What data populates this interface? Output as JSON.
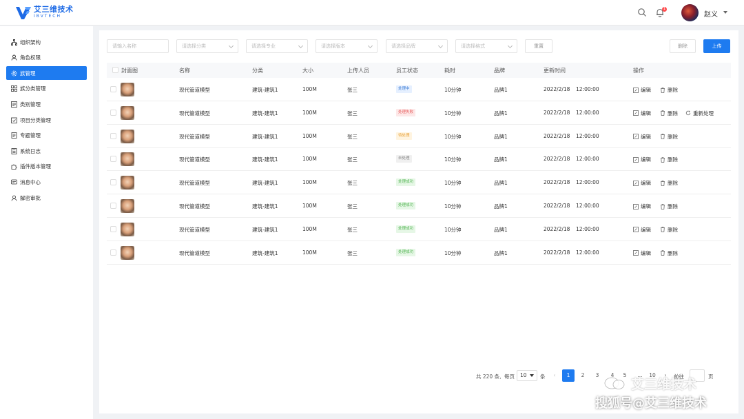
{
  "header": {
    "logo_cn": "艾三维技术",
    "logo_en": "IBVTECH",
    "notification_count": "1",
    "username": "赵义"
  },
  "sidebar": {
    "items": [
      {
        "label": "组织架构",
        "icon": "org-icon"
      },
      {
        "label": "角色权限",
        "icon": "user-icon"
      },
      {
        "label": "族管理",
        "icon": "gear-icon",
        "active": true
      },
      {
        "label": "族分类管理",
        "icon": "grid-icon"
      },
      {
        "label": "类别管理",
        "icon": "list-icon"
      },
      {
        "label": "项目分类管理",
        "icon": "task-icon"
      },
      {
        "label": "专题管理",
        "icon": "doc-icon"
      },
      {
        "label": "系统日志",
        "icon": "log-icon"
      },
      {
        "label": "插件版本管理",
        "icon": "puzzle-icon"
      },
      {
        "label": "消息中心",
        "icon": "message-icon"
      },
      {
        "label": "解密审批",
        "icon": "approve-icon"
      }
    ]
  },
  "filters": {
    "name_placeholder": "请输入名称",
    "category_placeholder": "请选择分类",
    "major_placeholder": "请选择专业",
    "version_placeholder": "请选择版本",
    "brand_placeholder": "请选择品牌",
    "format_placeholder": "请选择格式",
    "reset_label": "重置",
    "delete_label": "删除",
    "upload_label": "上传"
  },
  "table": {
    "headers": [
      "封面图",
      "名称",
      "分类",
      "大小",
      "上传人员",
      "员工状态",
      "耗时",
      "品牌",
      "更新时间",
      "操作"
    ],
    "rows": [
      {
        "name": "现代管道模型",
        "category": "建筑-建筑1",
        "size": "100M",
        "uploader": "张三",
        "status": "处理中",
        "status_type": "processing",
        "duration": "10分钟",
        "brand": "品牌1",
        "date": "2022/2/18",
        "time": "12:00:00",
        "reprocess": false
      },
      {
        "name": "现代管道模型",
        "category": "建筑-建筑1",
        "size": "100M",
        "uploader": "张三",
        "status": "处理失败",
        "status_type": "failed",
        "duration": "10分钟",
        "brand": "品牌1",
        "date": "2022/2/18",
        "time": "12:00:00",
        "reprocess": true
      },
      {
        "name": "现代管道模型",
        "category": "建筑-建筑1",
        "size": "100M",
        "uploader": "张三",
        "status": "待处理",
        "status_type": "pending",
        "duration": "10分钟",
        "brand": "品牌1",
        "date": "2022/2/18",
        "time": "12:00:00",
        "reprocess": false
      },
      {
        "name": "现代管道模型",
        "category": "建筑-建筑1",
        "size": "100M",
        "uploader": "张三",
        "status": "未处理",
        "status_type": "none",
        "duration": "10分钟",
        "brand": "品牌1",
        "date": "2022/2/18",
        "time": "12:00:00",
        "reprocess": false
      },
      {
        "name": "现代管道模型",
        "category": "建筑-建筑1",
        "size": "100M",
        "uploader": "张三",
        "status": "处理成功",
        "status_type": "success",
        "duration": "10分钟",
        "brand": "品牌1",
        "date": "2022/2/18",
        "time": "12:00:00",
        "reprocess": false
      },
      {
        "name": "现代管道模型",
        "category": "建筑-建筑1",
        "size": "100M",
        "uploader": "张三",
        "status": "处理成功",
        "status_type": "success",
        "duration": "10分钟",
        "brand": "品牌1",
        "date": "2022/2/18",
        "time": "12:00:00",
        "reprocess": false
      },
      {
        "name": "现代管道模型",
        "category": "建筑-建筑1",
        "size": "100M",
        "uploader": "张三",
        "status": "处理成功",
        "status_type": "success",
        "duration": "10分钟",
        "brand": "品牌1",
        "date": "2022/2/18",
        "time": "12:00:00",
        "reprocess": false
      },
      {
        "name": "现代管道模型",
        "category": "建筑-建筑1",
        "size": "100M",
        "uploader": "张三",
        "status": "处理成功",
        "status_type": "success",
        "duration": "10分钟",
        "brand": "品牌1",
        "date": "2022/2/18",
        "time": "12:00:00",
        "reprocess": false
      }
    ],
    "edit_label": "编辑",
    "delete_label": "删除",
    "reprocess_label": "重新处理"
  },
  "pagination": {
    "total_text": "共 220 条,",
    "per_page_prefix": "每页",
    "page_size": "10",
    "per_page_suffix": "条",
    "pages": [
      "1",
      "2",
      "3",
      "4",
      "5",
      "...",
      "10"
    ],
    "current_page": "1",
    "goto_label": "前往",
    "page_suffix": "页"
  },
  "watermark": {
    "line1": "艾三维技术",
    "line2": "搜狐号@艾三维技术"
  },
  "colors": {
    "primary": "#1e7bf0",
    "processing_bg": "#e6f0ff",
    "processing_fg": "#3a7bd5",
    "failed_bg": "#fde8e8",
    "failed_fg": "#e86060",
    "pending_bg": "#fff4e0",
    "pending_fg": "#e8a23a",
    "none_bg": "#f0f0f0",
    "none_fg": "#888888",
    "success_bg": "#e6f7e6",
    "success_fg": "#52b452"
  }
}
